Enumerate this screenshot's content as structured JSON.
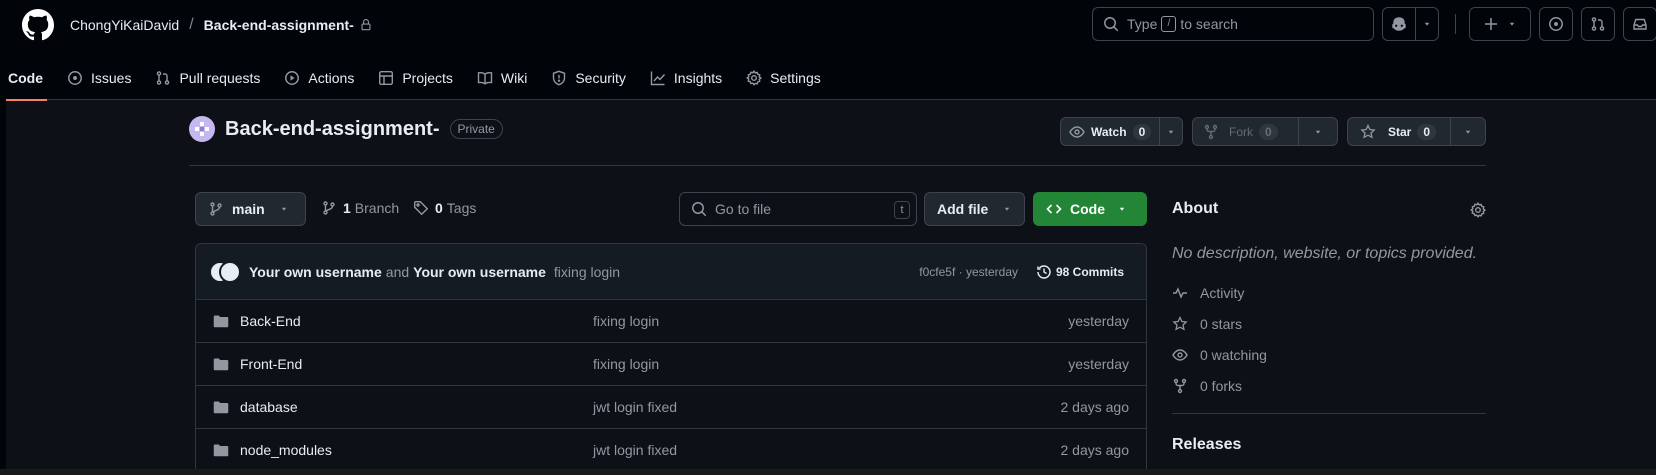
{
  "header": {
    "owner": "ChongYiKaiDavid",
    "separator": "/",
    "repo": "Back-end-assignment-",
    "search_prefix": "Type",
    "search_key": "/",
    "search_suffix": "to search"
  },
  "nav": {
    "tabs": [
      {
        "label": "Code",
        "icon": "code-icon"
      },
      {
        "label": "Issues",
        "icon": "issue-icon"
      },
      {
        "label": "Pull requests",
        "icon": "pull-request-icon"
      },
      {
        "label": "Actions",
        "icon": "play-icon"
      },
      {
        "label": "Projects",
        "icon": "table-icon"
      },
      {
        "label": "Wiki",
        "icon": "book-icon"
      },
      {
        "label": "Security",
        "icon": "shield-icon"
      },
      {
        "label": "Insights",
        "icon": "graph-icon"
      },
      {
        "label": "Settings",
        "icon": "gear-icon"
      }
    ],
    "active": "Code"
  },
  "repo": {
    "name": "Back-end-assignment-",
    "visibility": "Private",
    "watch_label": "Watch",
    "watch_count": "0",
    "fork_label": "Fork",
    "fork_count": "0",
    "star_label": "Star",
    "star_count": "0"
  },
  "filenav": {
    "branch": "main",
    "branch_count": "1",
    "branch_label": "Branch",
    "tag_count": "0",
    "tag_label": "Tags",
    "goto_placeholder": "Go to file",
    "goto_key": "t",
    "add_file": "Add file",
    "code": "Code"
  },
  "commit": {
    "author1": "Your own username",
    "and": "and",
    "author2": "Your own username",
    "message": "fixing login",
    "sha": "f0cfe5f · yesterday",
    "count_label": "98 Commits"
  },
  "files": [
    {
      "name": "Back-End",
      "message": "fixing login",
      "date": "yesterday"
    },
    {
      "name": "Front-End",
      "message": "fixing login",
      "date": "yesterday"
    },
    {
      "name": "database",
      "message": "jwt login fixed",
      "date": "2 days ago"
    },
    {
      "name": "node_modules",
      "message": "jwt login fixed",
      "date": "2 days ago"
    }
  ],
  "about": {
    "title": "About",
    "description": "No description, website, or topics provided.",
    "activity": "Activity",
    "stars": "0 stars",
    "watching": "0 watching",
    "forks": "0 forks",
    "releases": "Releases"
  },
  "colors": {
    "accent_tab": "#f78166",
    "code_button": "#238636",
    "background": "#0d1117"
  }
}
